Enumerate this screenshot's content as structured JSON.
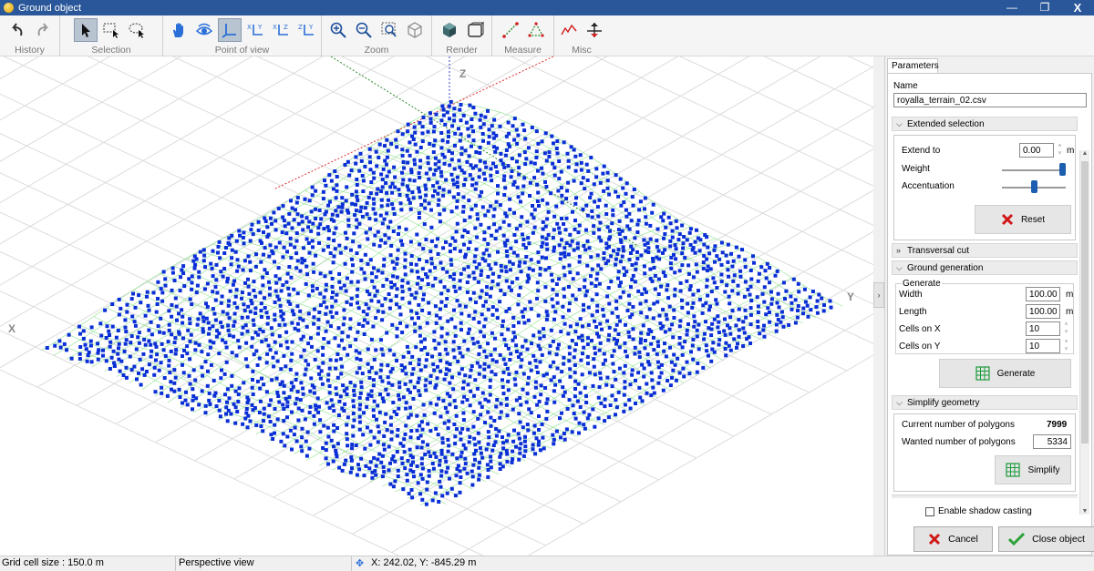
{
  "window": {
    "title": "Ground object",
    "minimize": "—",
    "restore": "❐",
    "close": "X"
  },
  "toolbar": {
    "groups": [
      {
        "label": "History"
      },
      {
        "label": "Selection"
      },
      {
        "label": "Point of view"
      },
      {
        "label": "Zoom"
      },
      {
        "label": "Render"
      },
      {
        "label": "Measure"
      },
      {
        "label": "Misc"
      }
    ]
  },
  "viewport": {
    "axis_x": "X",
    "axis_y": "Y",
    "axis_z": "Z",
    "colors": {
      "points": "#0a2fd6",
      "mesh": "#8fe28f",
      "grid": "#dcdcdc",
      "x_axis": "#e03030",
      "y_axis": "#2a8a2a",
      "z_axis": "#3040d0"
    }
  },
  "panel": {
    "tab": "Parameters",
    "name_label": "Name",
    "name_value": "royalla_terrain_02.csv",
    "extended_selection": {
      "title": "Extended selection",
      "extend_to_label": "Extend to",
      "extend_to_value": "0.00",
      "extend_to_unit": "m",
      "weight_label": "Weight",
      "weight_level": 1.0,
      "accentuation_label": "Accentuation",
      "accentuation_level": 0.5,
      "reset_label": "Reset"
    },
    "transversal_cut": {
      "title": "Transversal cut"
    },
    "ground_generation": {
      "title": "Ground generation",
      "group_label": "Generate",
      "width_label": "Width",
      "width_value": "100.00",
      "width_unit": "m",
      "length_label": "Length",
      "length_value": "100.00",
      "length_unit": "m",
      "cells_x_label": "Cells on X",
      "cells_x_value": "10",
      "cells_y_label": "Cells on Y",
      "cells_y_value": "10",
      "generate_label": "Generate"
    },
    "simplify": {
      "title": "Simplify geometry",
      "current_label": "Current number of polygons",
      "current_value": "7999",
      "wanted_label": "Wanted number of polygons",
      "wanted_value": "5334",
      "simplify_label": "Simplify"
    },
    "shadow_label": "Enable shadow casting",
    "cancel_label": "Cancel",
    "close_label": "Close object"
  },
  "status": {
    "grid_cell": "Grid cell size : 150.0 m",
    "view": "Perspective view",
    "coords": "X: 242.02,  Y: -845.29 m"
  }
}
